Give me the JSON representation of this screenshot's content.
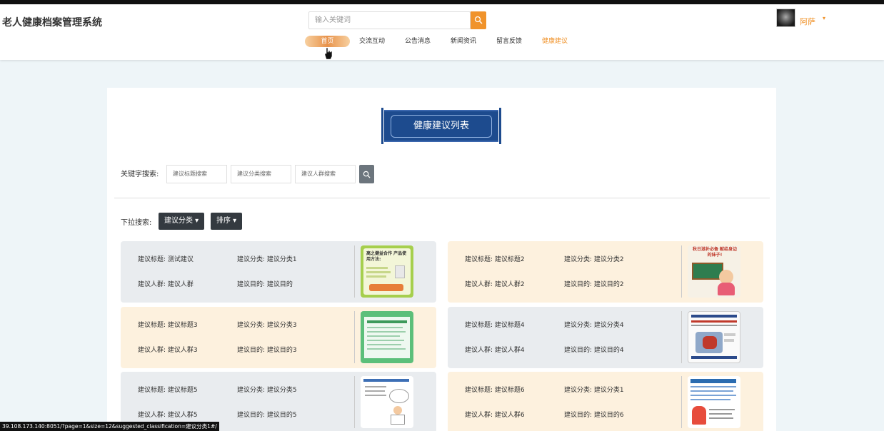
{
  "site": {
    "title": "老人健康档案管理系统"
  },
  "search": {
    "placeholder": "输入关键词"
  },
  "user": {
    "name": "阿萨",
    "caret": "▾"
  },
  "nav": [
    "首页",
    "交流互动",
    "公告消息",
    "新闻资讯",
    "留言反馈",
    "健康建议"
  ],
  "page": {
    "banner_title": "健康建议列表"
  },
  "filters": {
    "keyword_label": "关键字搜索:",
    "title_placeholder": "建议标题搜索",
    "category_placeholder": "建议分类搜索",
    "group_placeholder": "建议人群搜索",
    "dropdown_label": "下拉搜索:",
    "category_button": "建议分类 ▾",
    "sort_button": "排序 ▾"
  },
  "cards": [
    {
      "title": "建议标题: 测试建议",
      "category": "建议分类: 建议分类1",
      "group": "建议人群: 建议人群",
      "purpose": "建议目的: 建议目的",
      "thumb_text": "高之健益合作 产品使用方法:"
    },
    {
      "title": "建议标题: 建议标题2",
      "category": "建议分类: 建议分类2",
      "group": "建议人群: 建议人群2",
      "purpose": "建议目的: 建议目的2",
      "thumb_text": "秋日滋补必备 献给身边的妹子!"
    },
    {
      "title": "建议标题: 建议标题3",
      "category": "建议分类: 建议分类3",
      "group": "建议人群: 建议人群3",
      "purpose": "建议目的: 建议目的3",
      "thumb_text": ""
    },
    {
      "title": "建议标题: 建议标题4",
      "category": "建议分类: 建议分类4",
      "group": "建议人群: 建议人群4",
      "purpose": "建议目的: 建议目的4",
      "thumb_text": ""
    },
    {
      "title": "建议标题: 建议标题5",
      "category": "建议分类: 建议分类5",
      "group": "建议人群: 建议人群5",
      "purpose": "建议目的: 建议目的5",
      "thumb_text": ""
    },
    {
      "title": "建议标题: 建议标题6",
      "category": "建议分类: 建议分类1",
      "group": "建议人群: 建议人群6",
      "purpose": "建议目的: 建议目的6",
      "thumb_text": ""
    }
  ],
  "status_url": "39.108.173.140:8051/?page=1&size=12&suggested_classification=建议分类1#/",
  "colors": {
    "accent": "#f0932b",
    "card_gray": "#e9ecef",
    "card_peach": "#fdf1de",
    "banner_blue": "#1d4b8e",
    "dark_button": "#343a40"
  },
  "icons": [
    "search-icon",
    "cursor-hand-icon",
    "caret-down-icon"
  ]
}
